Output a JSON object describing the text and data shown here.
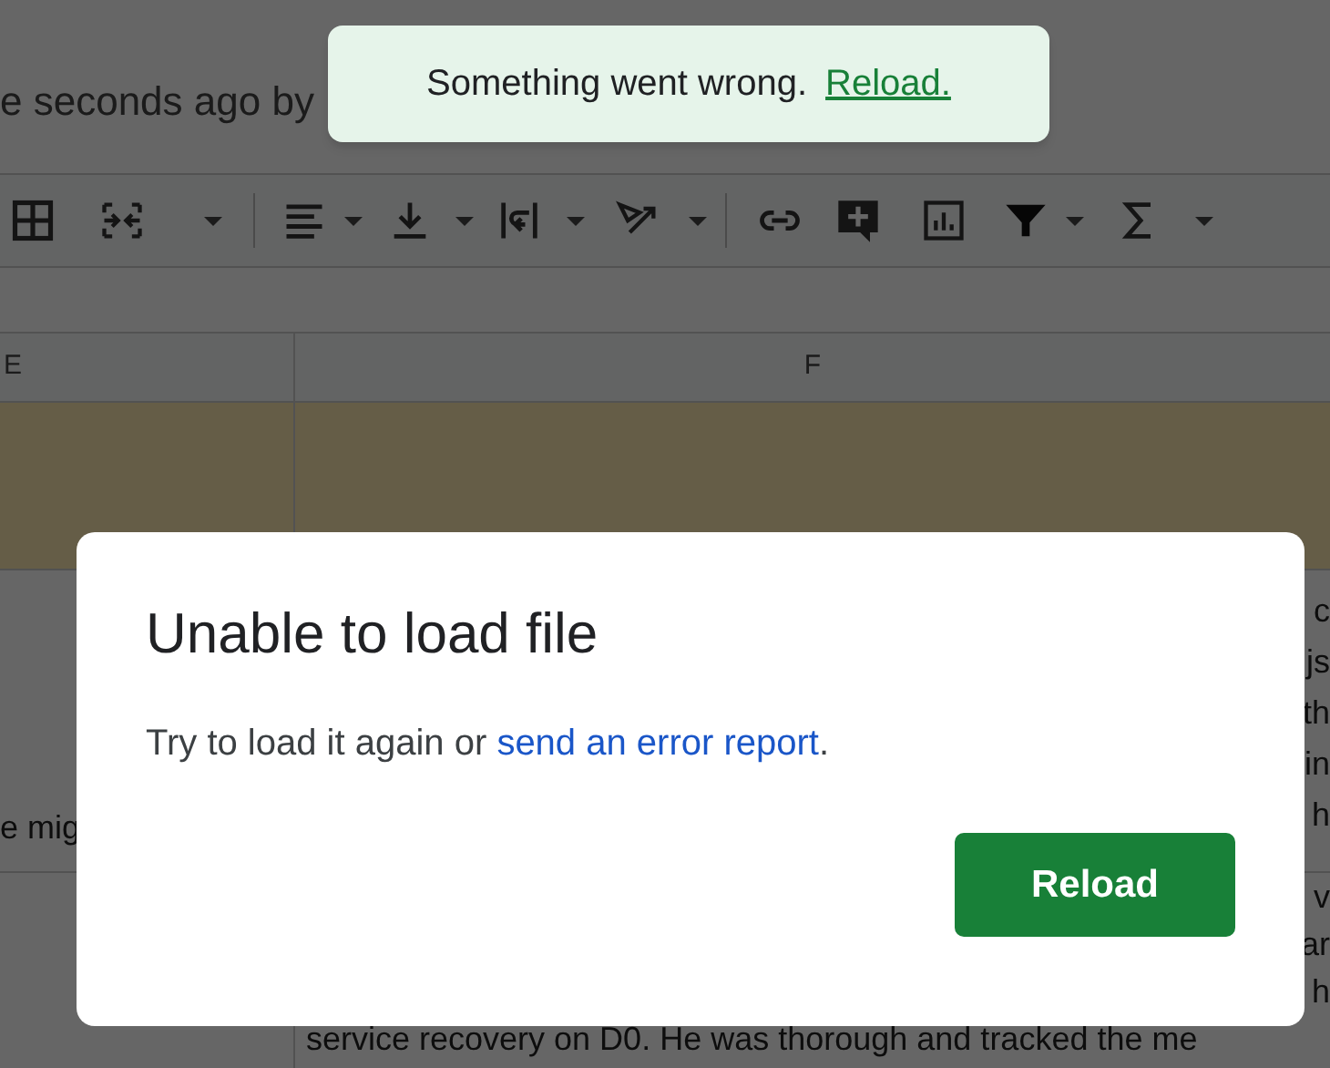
{
  "sheet": {
    "last_edit": "e seconds ago by",
    "columns": [
      "E",
      "F"
    ],
    "rows": [
      {
        "column_e": "e mig",
        "column_f_lines": [
          "c",
          "js",
          "th",
          "in",
          "h"
        ]
      },
      {
        "column_e": "",
        "column_f_lines": [
          "v",
          "ar",
          "h",
          "service recovery on D0. He was thorough and tracked the me"
        ]
      }
    ]
  },
  "toast": {
    "message": "Something went wrong.",
    "link": "Reload."
  },
  "dialog": {
    "title": "Unable to load file",
    "text": "Try to load it again or",
    "link": "send an error report",
    "after_link": ".",
    "buttons": [
      "Reload"
    ]
  }
}
